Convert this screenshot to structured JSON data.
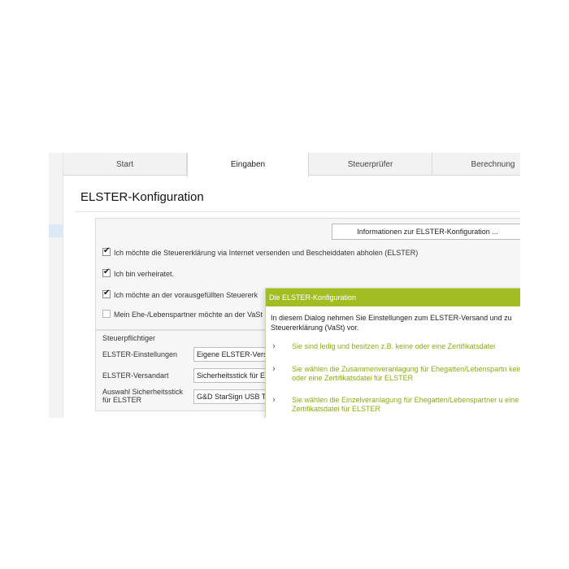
{
  "tabs": [
    {
      "label": "Start"
    },
    {
      "label": "Eingaben"
    },
    {
      "label": "Steuerprüfer"
    },
    {
      "label": "Berechnung"
    }
  ],
  "page": {
    "title": "ELSTER-Konfiguration",
    "info_button": "Informationen zur ELSTER-Konfiguration ...",
    "checkboxes": [
      {
        "label": "Ich möchte die Steuererklärung via Internet versenden und Bescheiddaten abholen (ELSTER)",
        "checked": true
      },
      {
        "label": "Ich bin verheiratet.",
        "checked": true
      },
      {
        "label": "Ich möchte an der vorausgefüllten Steuererk",
        "checked": true
      },
      {
        "label": "Mein Ehe-/Lebenspartner möchte an der VaSt",
        "checked": false
      }
    ],
    "steuerpflichtiger": {
      "legend": "Steuerpflichtiger",
      "fields": [
        {
          "label": "ELSTER-Einstellungen",
          "value": "Eigene ELSTER-Versa"
        },
        {
          "label": "ELSTER-Versandart",
          "value": "Sicherheitsstick für E"
        },
        {
          "label": "Auswahl Sicherheitsstick für ELSTER",
          "value": "G&D StarSign USB To"
        }
      ]
    }
  },
  "dialog": {
    "title": "Die ELSTER-Konfiguration",
    "description": "In diesem Dialog nehmen Sie Einstellungen zum ELSTER-Versand und zu Steuererklärung (VaSt) vor.",
    "options": [
      {
        "text": "Sie sind ledig und besitzen z.B. keine oder eine Zertifikatsdatei"
      },
      {
        "text": "Sie wählen die Zusammenveranlagung für Ehegatten/Lebenspartn keine oder eine Zertifikatsdatei für ELSTER"
      },
      {
        "text": "Sie wählen die Einzelveranlagung für Ehegatten/Lebenspartner u eine Zertifikatsdatei für ELSTER"
      }
    ]
  },
  "colors": {
    "accent": "#a2bd22",
    "option_text": "#8aaa16"
  },
  "icons": {
    "option_chevron": "chevron-right-icon",
    "checkbox": "checkmark-icon"
  }
}
